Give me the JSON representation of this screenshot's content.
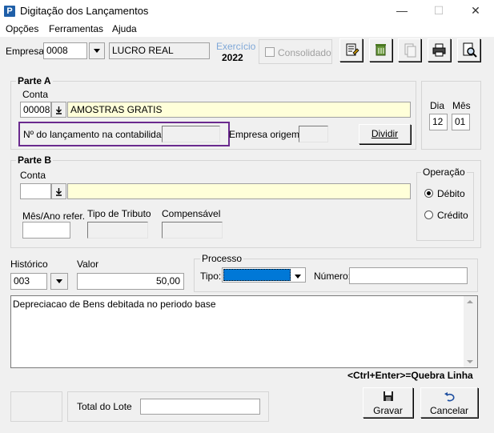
{
  "window": {
    "title": "Digitação dos Lançamentos",
    "icon_letter": "P",
    "minimize": "—",
    "maximize": "☐",
    "close": "✕"
  },
  "menu": [
    "Opções",
    "Ferramentas",
    "Ajuda"
  ],
  "header": {
    "empresa_label": "Empresa:",
    "empresa_value": "0008",
    "empresa_name": "LUCRO REAL",
    "exercicio_label": "Exercício",
    "exercicio_value": "2022",
    "consolidado_label": "Consolidado"
  },
  "toolbar": [
    "document-edit-icon",
    "recycle-icon",
    "document-copy-icon",
    "printer-icon",
    "preview-icon"
  ],
  "parte_a": {
    "title": "Parte A",
    "conta_label": "Conta",
    "conta_code": "00008",
    "conta_name": "AMOSTRAS GRATIS",
    "lancamento_label": "Nº do lançamento na contabilidade:",
    "lancamento_value": "",
    "empresa_origem_label": "Empresa origem:",
    "dividir_label": "Dividir"
  },
  "date": {
    "dia_label": "Dia",
    "dia_value": "12",
    "mes_label": "Mês",
    "mes_value": "01"
  },
  "parte_b": {
    "title": "Parte B",
    "conta_label": "Conta",
    "mes_ano_label": "Mês/Ano refer.",
    "tipo_tributo_label": "Tipo de Tributo",
    "compensavel_label": "Compensável",
    "operacao_label": "Operação",
    "debito_label": "Débito",
    "credito_label": "Crédito",
    "selected_operacao": "Débito"
  },
  "historico": {
    "label": "Histórico",
    "value": "003"
  },
  "valor": {
    "label": "Valor",
    "value": "50,00"
  },
  "processo": {
    "title": "Processo",
    "tipo_label": "Tipo:",
    "numero_label": "Número:"
  },
  "description_text": "Depreciacao de Bens debitada no periodo base",
  "hint": "<Ctrl+Enter>=Quebra Linha",
  "footer": {
    "total_lote_label": "Total do Lote",
    "total_lote_value": "",
    "gravar_label": "Gravar",
    "cancelar_label": "Cancelar"
  },
  "colors": {
    "highlight": "#6a2a8e",
    "yellow_field": "#ffffd9",
    "selected_blue": "#0078d7"
  }
}
